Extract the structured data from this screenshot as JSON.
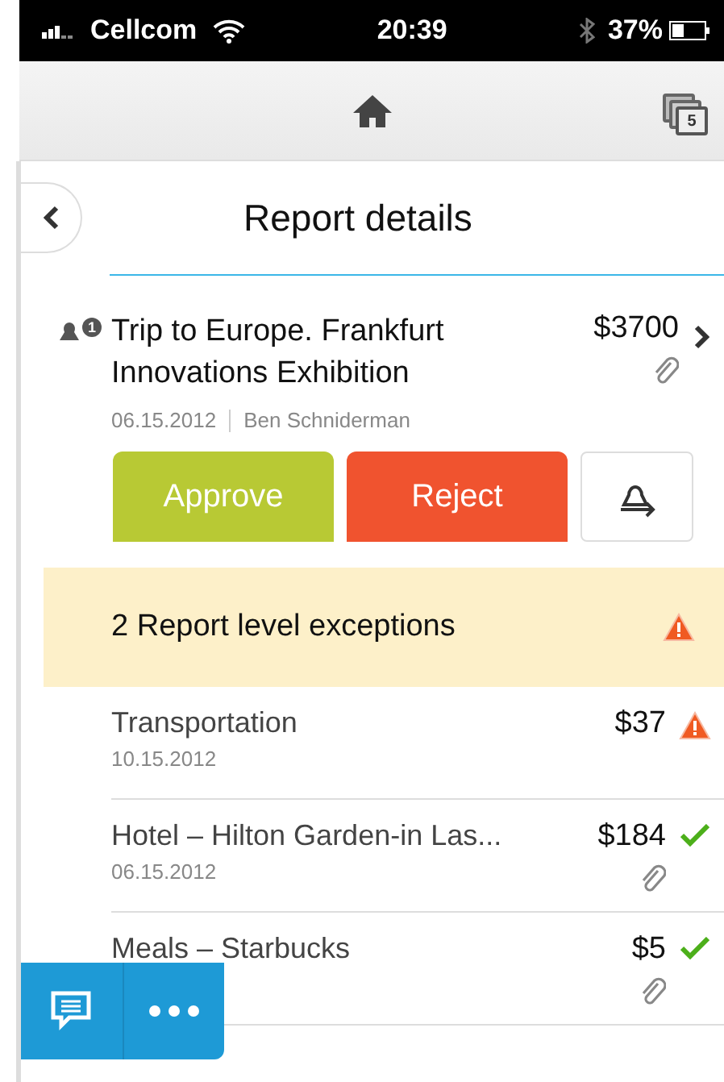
{
  "status_bar": {
    "carrier": "Cellcom",
    "time": "20:39",
    "battery": "37%"
  },
  "nav": {
    "stack_count": "5"
  },
  "header": {
    "title": "Report details"
  },
  "report": {
    "title": "Trip to Europe. Frankfurt Innovations Exhibition",
    "amount": "$3700",
    "attachment": true,
    "approver_count": "1",
    "date": "06.15.2012",
    "owner": "Ben Schniderman"
  },
  "actions": [
    {
      "kind": "approve",
      "label": "Approve"
    },
    {
      "kind": "reject",
      "label": "Reject"
    },
    {
      "kind": "delegate"
    }
  ],
  "exceptions": {
    "label": "2 Report level exceptions",
    "exception": true
  },
  "items": [
    {
      "title": "Transportation",
      "date": "10.15.2012",
      "amount": "$37",
      "exception": true,
      "attachment": false
    },
    {
      "title": "Hotel – Hilton Garden-in Las...",
      "date": "06.15.2012",
      "amount": "$184",
      "exception": false,
      "attachment": true
    },
    {
      "title": "Meals – Starbucks",
      "amount": "$5",
      "exception": false,
      "attachment": true
    }
  ]
}
